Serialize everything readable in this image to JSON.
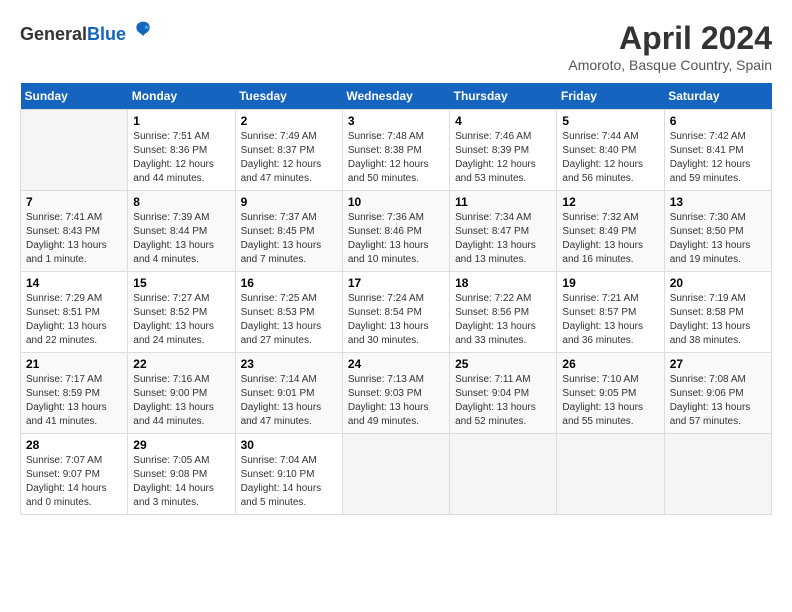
{
  "header": {
    "logo_general": "General",
    "logo_blue": "Blue",
    "title": "April 2024",
    "location": "Amoroto, Basque Country, Spain"
  },
  "days_of_week": [
    "Sunday",
    "Monday",
    "Tuesday",
    "Wednesday",
    "Thursday",
    "Friday",
    "Saturday"
  ],
  "weeks": [
    [
      {
        "day": "",
        "sunrise": "",
        "sunset": "",
        "daylight": ""
      },
      {
        "day": "1",
        "sunrise": "Sunrise: 7:51 AM",
        "sunset": "Sunset: 8:36 PM",
        "daylight": "Daylight: 12 hours and 44 minutes."
      },
      {
        "day": "2",
        "sunrise": "Sunrise: 7:49 AM",
        "sunset": "Sunset: 8:37 PM",
        "daylight": "Daylight: 12 hours and 47 minutes."
      },
      {
        "day": "3",
        "sunrise": "Sunrise: 7:48 AM",
        "sunset": "Sunset: 8:38 PM",
        "daylight": "Daylight: 12 hours and 50 minutes."
      },
      {
        "day": "4",
        "sunrise": "Sunrise: 7:46 AM",
        "sunset": "Sunset: 8:39 PM",
        "daylight": "Daylight: 12 hours and 53 minutes."
      },
      {
        "day": "5",
        "sunrise": "Sunrise: 7:44 AM",
        "sunset": "Sunset: 8:40 PM",
        "daylight": "Daylight: 12 hours and 56 minutes."
      },
      {
        "day": "6",
        "sunrise": "Sunrise: 7:42 AM",
        "sunset": "Sunset: 8:41 PM",
        "daylight": "Daylight: 12 hours and 59 minutes."
      }
    ],
    [
      {
        "day": "7",
        "sunrise": "Sunrise: 7:41 AM",
        "sunset": "Sunset: 8:43 PM",
        "daylight": "Daylight: 13 hours and 1 minute."
      },
      {
        "day": "8",
        "sunrise": "Sunrise: 7:39 AM",
        "sunset": "Sunset: 8:44 PM",
        "daylight": "Daylight: 13 hours and 4 minutes."
      },
      {
        "day": "9",
        "sunrise": "Sunrise: 7:37 AM",
        "sunset": "Sunset: 8:45 PM",
        "daylight": "Daylight: 13 hours and 7 minutes."
      },
      {
        "day": "10",
        "sunrise": "Sunrise: 7:36 AM",
        "sunset": "Sunset: 8:46 PM",
        "daylight": "Daylight: 13 hours and 10 minutes."
      },
      {
        "day": "11",
        "sunrise": "Sunrise: 7:34 AM",
        "sunset": "Sunset: 8:47 PM",
        "daylight": "Daylight: 13 hours and 13 minutes."
      },
      {
        "day": "12",
        "sunrise": "Sunrise: 7:32 AM",
        "sunset": "Sunset: 8:49 PM",
        "daylight": "Daylight: 13 hours and 16 minutes."
      },
      {
        "day": "13",
        "sunrise": "Sunrise: 7:30 AM",
        "sunset": "Sunset: 8:50 PM",
        "daylight": "Daylight: 13 hours and 19 minutes."
      }
    ],
    [
      {
        "day": "14",
        "sunrise": "Sunrise: 7:29 AM",
        "sunset": "Sunset: 8:51 PM",
        "daylight": "Daylight: 13 hours and 22 minutes."
      },
      {
        "day": "15",
        "sunrise": "Sunrise: 7:27 AM",
        "sunset": "Sunset: 8:52 PM",
        "daylight": "Daylight: 13 hours and 24 minutes."
      },
      {
        "day": "16",
        "sunrise": "Sunrise: 7:25 AM",
        "sunset": "Sunset: 8:53 PM",
        "daylight": "Daylight: 13 hours and 27 minutes."
      },
      {
        "day": "17",
        "sunrise": "Sunrise: 7:24 AM",
        "sunset": "Sunset: 8:54 PM",
        "daylight": "Daylight: 13 hours and 30 minutes."
      },
      {
        "day": "18",
        "sunrise": "Sunrise: 7:22 AM",
        "sunset": "Sunset: 8:56 PM",
        "daylight": "Daylight: 13 hours and 33 minutes."
      },
      {
        "day": "19",
        "sunrise": "Sunrise: 7:21 AM",
        "sunset": "Sunset: 8:57 PM",
        "daylight": "Daylight: 13 hours and 36 minutes."
      },
      {
        "day": "20",
        "sunrise": "Sunrise: 7:19 AM",
        "sunset": "Sunset: 8:58 PM",
        "daylight": "Daylight: 13 hours and 38 minutes."
      }
    ],
    [
      {
        "day": "21",
        "sunrise": "Sunrise: 7:17 AM",
        "sunset": "Sunset: 8:59 PM",
        "daylight": "Daylight: 13 hours and 41 minutes."
      },
      {
        "day": "22",
        "sunrise": "Sunrise: 7:16 AM",
        "sunset": "Sunset: 9:00 PM",
        "daylight": "Daylight: 13 hours and 44 minutes."
      },
      {
        "day": "23",
        "sunrise": "Sunrise: 7:14 AM",
        "sunset": "Sunset: 9:01 PM",
        "daylight": "Daylight: 13 hours and 47 minutes."
      },
      {
        "day": "24",
        "sunrise": "Sunrise: 7:13 AM",
        "sunset": "Sunset: 9:03 PM",
        "daylight": "Daylight: 13 hours and 49 minutes."
      },
      {
        "day": "25",
        "sunrise": "Sunrise: 7:11 AM",
        "sunset": "Sunset: 9:04 PM",
        "daylight": "Daylight: 13 hours and 52 minutes."
      },
      {
        "day": "26",
        "sunrise": "Sunrise: 7:10 AM",
        "sunset": "Sunset: 9:05 PM",
        "daylight": "Daylight: 13 hours and 55 minutes."
      },
      {
        "day": "27",
        "sunrise": "Sunrise: 7:08 AM",
        "sunset": "Sunset: 9:06 PM",
        "daylight": "Daylight: 13 hours and 57 minutes."
      }
    ],
    [
      {
        "day": "28",
        "sunrise": "Sunrise: 7:07 AM",
        "sunset": "Sunset: 9:07 PM",
        "daylight": "Daylight: 14 hours and 0 minutes."
      },
      {
        "day": "29",
        "sunrise": "Sunrise: 7:05 AM",
        "sunset": "Sunset: 9:08 PM",
        "daylight": "Daylight: 14 hours and 3 minutes."
      },
      {
        "day": "30",
        "sunrise": "Sunrise: 7:04 AM",
        "sunset": "Sunset: 9:10 PM",
        "daylight": "Daylight: 14 hours and 5 minutes."
      },
      {
        "day": "",
        "sunrise": "",
        "sunset": "",
        "daylight": ""
      },
      {
        "day": "",
        "sunrise": "",
        "sunset": "",
        "daylight": ""
      },
      {
        "day": "",
        "sunrise": "",
        "sunset": "",
        "daylight": ""
      },
      {
        "day": "",
        "sunrise": "",
        "sunset": "",
        "daylight": ""
      }
    ]
  ]
}
